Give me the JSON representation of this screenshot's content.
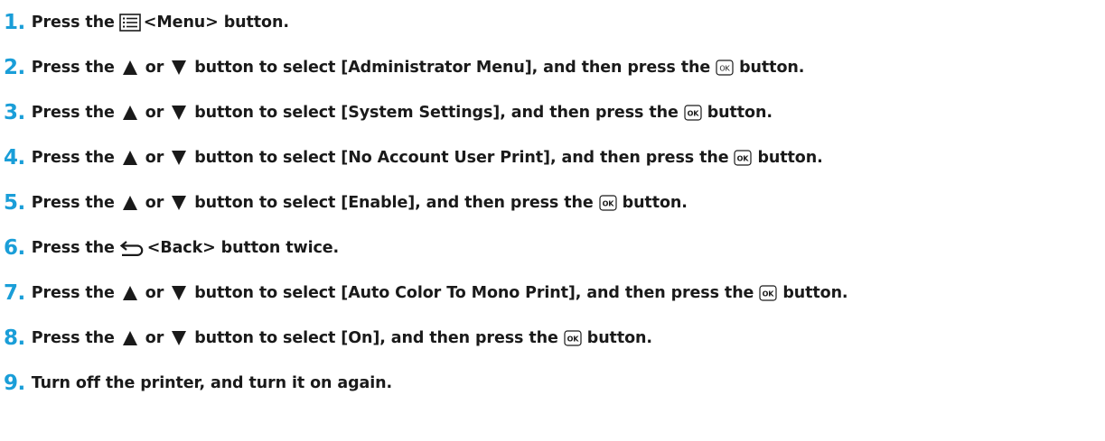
{
  "accent_color": "#1a9ed8",
  "text_color": "#1a1a1a",
  "icons": {
    "menu": "menu-icon",
    "up": "up-arrow-icon",
    "down": "down-arrow-icon",
    "ok": "ok-button-icon",
    "back": "back-icon"
  },
  "ok_icon_label": "OK",
  "s1": {
    "num": "1.",
    "a": "Press the",
    "b": "<Menu> button."
  },
  "s2": {
    "num": "2.",
    "a": "Press the",
    "or": "or",
    "b": "button to select [Administrator Menu], and then press the",
    "c": "button."
  },
  "s3": {
    "num": "3.",
    "a": "Press the",
    "or": "or",
    "b": "button to select [System Settings], and then press the",
    "c": "button."
  },
  "s4": {
    "num": "4.",
    "a": "Press the",
    "or": "or",
    "b": "button to select [No Account User Print], and then press the",
    "c": "button."
  },
  "s5": {
    "num": "5.",
    "a": "Press the",
    "or": "or",
    "b": "button to select [Enable], and then press the",
    "c": "button."
  },
  "s6": {
    "num": "6.",
    "a": "Press the",
    "b": "<Back> button twice."
  },
  "s7": {
    "num": "7.",
    "a": "Press the",
    "or": "or",
    "b": "button to select [Auto Color To Mono Print], and then press the",
    "c": "button."
  },
  "s8": {
    "num": "8.",
    "a": "Press the",
    "or": "or",
    "b": "button to select [On], and then press the",
    "c": "button."
  },
  "s9": {
    "num": "9.",
    "a": "Turn off the printer, and turn it on again."
  }
}
